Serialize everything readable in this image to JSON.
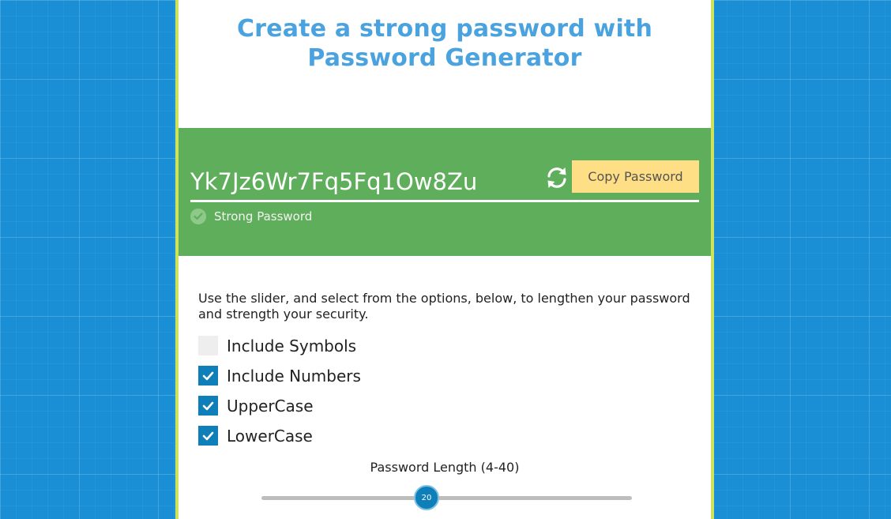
{
  "header": {
    "title": "Create a strong password with Password Generator"
  },
  "result": {
    "password": "Yk7Jz6Wr7Fq5Fq1Ow8Zu",
    "copy_label": "Copy Password",
    "strength_text": "Strong Password"
  },
  "options": {
    "instructions": "Use the slider, and select from the options, below, to lengthen your password and strength your security.",
    "items": [
      {
        "label": "Include Symbols",
        "checked": false
      },
      {
        "label": "Include Numbers",
        "checked": true
      },
      {
        "label": "UpperCase",
        "checked": true
      },
      {
        "label": "LowerCase",
        "checked": true
      }
    ]
  },
  "slider": {
    "label": "Password Length (4-40)",
    "value": "20",
    "min": 4,
    "max": 40
  },
  "colors": {
    "title": "#4aa3df",
    "panel": "#5fae5b",
    "copy_button": "#ffdf86",
    "accent": "#0e7fb8",
    "background": "#1a8fd6"
  },
  "icons": {
    "refresh": "refresh-icon",
    "strength": "check-circle-icon",
    "checkmark": "checkmark-icon"
  }
}
